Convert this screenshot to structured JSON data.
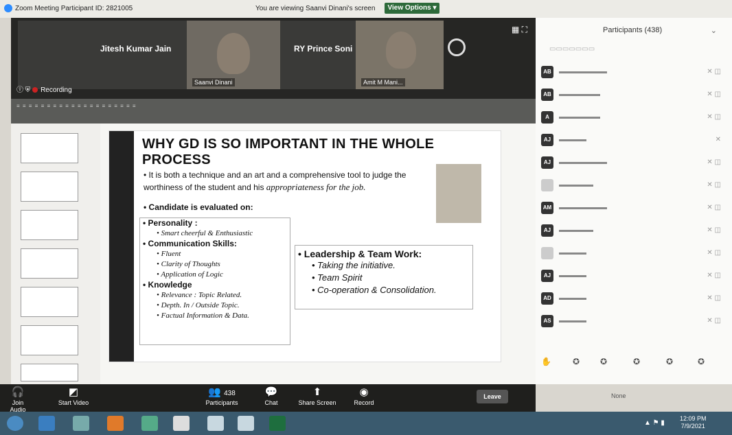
{
  "window": {
    "title": "Zoom Meeting Participant ID: 2821005",
    "viewing": "You are viewing Saanvi Dinani's screen",
    "view_options": "View Options ▾"
  },
  "video": {
    "tiles": [
      {
        "name": "Jitesh Kumar Jain",
        "label": ""
      },
      {
        "name": "",
        "label": "Saanvi Dinani"
      },
      {
        "name": "RY Prince Soni",
        "label": ""
      },
      {
        "name": "",
        "label": "Amit M Mani..."
      }
    ],
    "recording": "Recording"
  },
  "slide": {
    "heading": "WHY GD IS SO IMPORTANT IN THE WHOLE PROCESS",
    "intro_plain": "• It is both a technique and an art and a comprehensive tool to judge the worthiness of the student and his ",
    "intro_em": "appropriateness for the job.",
    "evaluated": "• Candidate is evaluated on:",
    "box1": [
      {
        "h": "• Personality :",
        "items": [
          "• Smart cheerful & Enthusiastic"
        ]
      },
      {
        "h": "• Communication Skills:",
        "items": [
          "• Fluent",
          "• Clarity of Thoughts",
          "• Application of Logic"
        ]
      },
      {
        "h": "• Knowledge",
        "items": [
          "• Relevance : Topic Related.",
          "• Depth. In / Outside Topic.",
          "• Factual Information & Data."
        ]
      }
    ],
    "box2": {
      "h": "• Leadership & Team Work:",
      "items": [
        "• Taking the initiative.",
        "• Team Spirit",
        "• Co-operation & Consolidation."
      ]
    }
  },
  "participants": {
    "title": "Participants (438)",
    "rows": [
      {
        "av": "AB"
      },
      {
        "av": "AB"
      },
      {
        "av": "A"
      },
      {
        "av": "AJ"
      },
      {
        "av": "AJ"
      },
      {
        "av": ""
      },
      {
        "av": "AM"
      },
      {
        "av": "AJ"
      },
      {
        "av": ""
      },
      {
        "av": "AJ"
      },
      {
        "av": "AD"
      },
      {
        "av": "AS"
      }
    ],
    "none": "None"
  },
  "controls": {
    "join_audio": "Join Audio",
    "start_video": "Start Video",
    "participants": "Participants",
    "participants_count": "438",
    "chat": "Chat",
    "share_screen": "Share Screen",
    "record": "Record",
    "leave": "Leave"
  },
  "taskbar": {
    "time": "12:09 PM",
    "date": "7/9/2021"
  },
  "colors": {
    "video_bg": "#262624",
    "view_options_bg": "#2d6a3a",
    "taskbar_bg": "#3a5a6e"
  }
}
